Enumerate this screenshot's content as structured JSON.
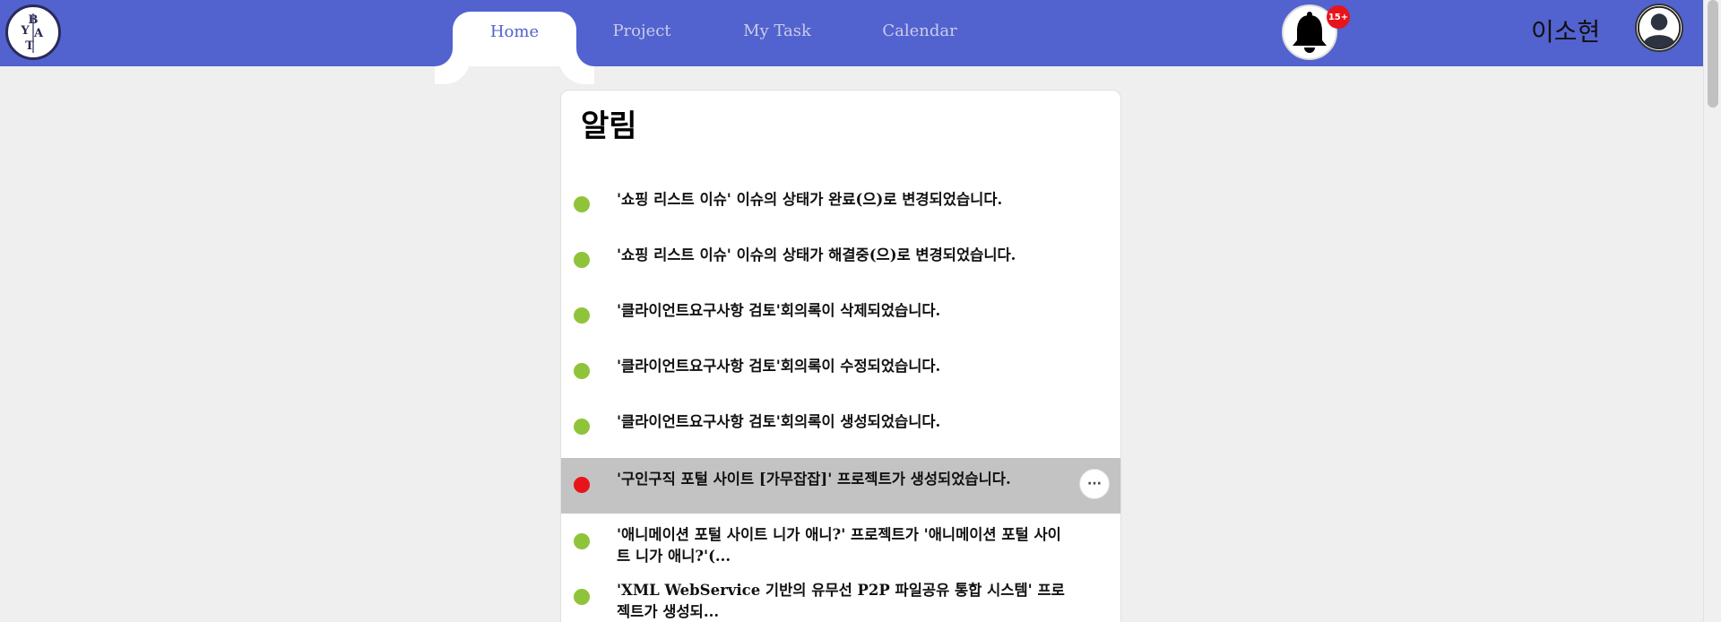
{
  "header": {
    "logo_text": "BYAT",
    "tabs": [
      {
        "label": "Home",
        "active": true
      },
      {
        "label": "Project",
        "active": false
      },
      {
        "label": "My Task",
        "active": false
      },
      {
        "label": "Calendar",
        "active": false
      }
    ],
    "notification_count": "15+",
    "username": "이소현",
    "bar_color": "#5262cf"
  },
  "notifications": {
    "title": "알림",
    "items": [
      {
        "text": "'쇼핑 리스트 이슈' 이슈의 상태가 완료(으)로 변경되었습니다.",
        "status": "read",
        "dot_color": "#8fc43a"
      },
      {
        "text": "'쇼핑 리스트 이슈' 이슈의 상태가 해결중(으)로 변경되었습니다.",
        "status": "read",
        "dot_color": "#8fc43a"
      },
      {
        "text": "'클라이언트요구사항 검토'회의록이 삭제되었습니다.",
        "status": "read",
        "dot_color": "#8fc43a"
      },
      {
        "text": "'클라이언트요구사항 검토'회의록이 수정되었습니다.",
        "status": "read",
        "dot_color": "#8fc43a"
      },
      {
        "text": "'클라이언트요구사항 검토'회의록이 생성되었습니다.",
        "status": "read",
        "dot_color": "#8fc43a"
      },
      {
        "text": "'구인구직 포털 사이트 [가무잡잡]' 프로젝트가 생성되었습니다.",
        "status": "unread",
        "dot_color": "#e8141b",
        "highlighted": true,
        "more_label": "···"
      },
      {
        "text": "'애니메이션 포털 사이트 니가 애니?' 프로젝트가 '애니메이션 포털 사이트 니가 애니?'(...",
        "status": "read",
        "dot_color": "#8fc43a"
      },
      {
        "text": "'XML WebService 기반의 유무선 P2P 파일공유 통합 시스템' 프로젝트가 생성되...",
        "status": "read",
        "dot_color": "#8fc43a"
      }
    ]
  }
}
